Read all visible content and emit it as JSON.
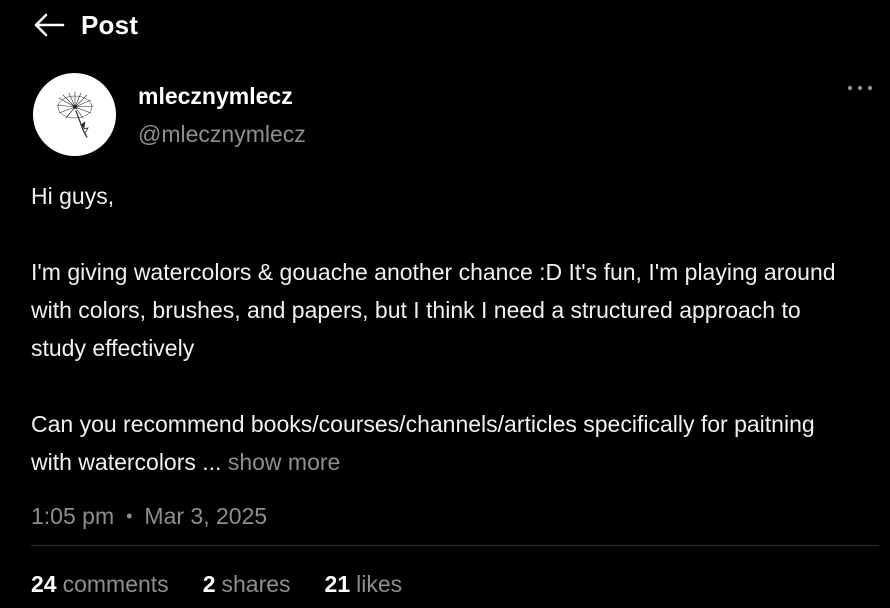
{
  "header": {
    "title": "Post",
    "back_icon": "arrow-left-icon"
  },
  "author": {
    "display_name": "mlecznymlecz",
    "handle": "@mlecznymlecz",
    "avatar_icon": "dandelion-avatar"
  },
  "more_icon": "more-horizontal-icon",
  "post": {
    "paragraphs": [
      "Hi guys,",
      "I'm giving watercolors & gouache another chance :D It's fun, I'm playing around with colors, brushes, and papers, but I think I need a structured approach to study effectively",
      "Can you recommend books/courses/channels/articles specifically for paitning with watercolors ..."
    ],
    "show_more_label": "show more"
  },
  "meta": {
    "time": "1:05 pm",
    "separator": "•",
    "date": "Mar 3, 2025"
  },
  "stats": {
    "comments_count": "24",
    "comments_label": "comments",
    "shares_count": "2",
    "shares_label": "shares",
    "likes_count": "21",
    "likes_label": "likes"
  },
  "colors": {
    "background": "#000000",
    "text_primary": "#ffffff",
    "text_secondary": "#8b8f94",
    "divider": "#2f3336"
  }
}
